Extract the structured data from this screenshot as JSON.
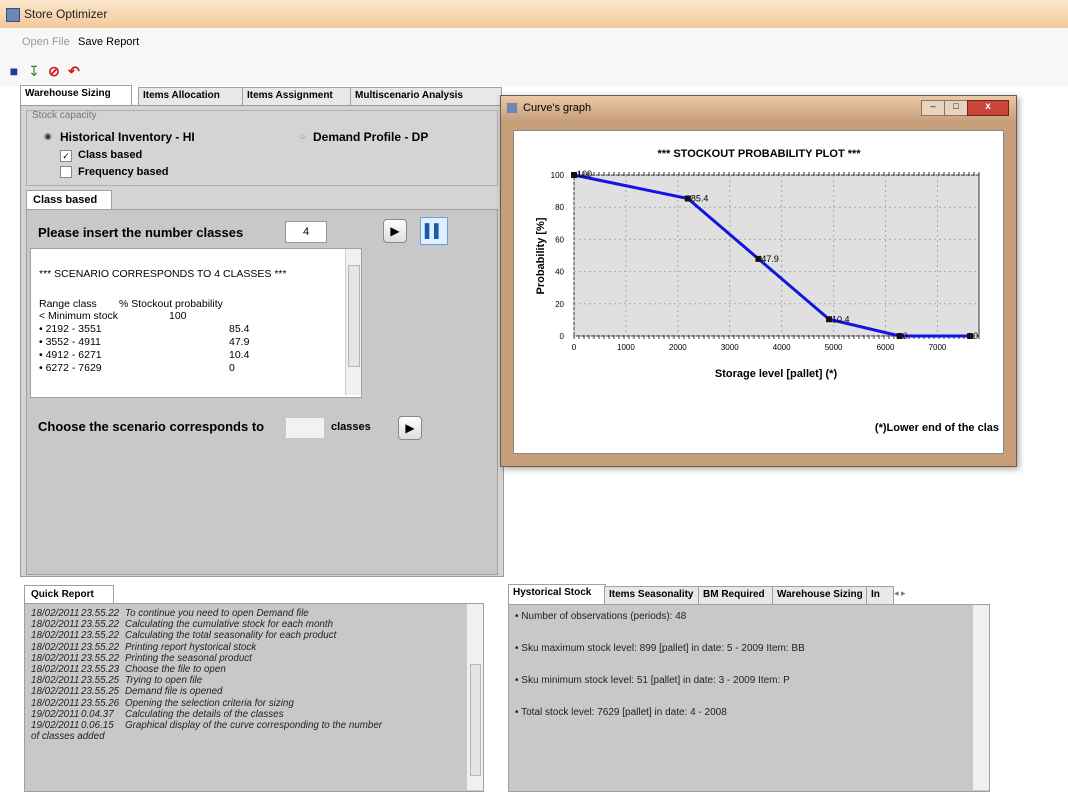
{
  "app": {
    "title": "Store Optimizer"
  },
  "menu": {
    "open_file": "Open File",
    "save_report": "Save Report"
  },
  "toolbar": {
    "icons": [
      "save-icon",
      "download-icon",
      "stop-icon",
      "undo-icon"
    ]
  },
  "main_tabs": [
    {
      "label": "Warehouse Sizing",
      "active": true
    },
    {
      "label": "Items Allocation"
    },
    {
      "label": "Items Assignment"
    },
    {
      "label": "Multiscenario Analysis"
    }
  ],
  "stock_capacity": {
    "label": "Stock capacity",
    "historical": "Historical  Inventory - HI",
    "demand": "Demand Profile - DP",
    "class_based": "Class based",
    "frequency_based": "Frequency based"
  },
  "class_panel": {
    "tab": "Class based",
    "insert_label": "Please insert the number classes",
    "classes_value": "4",
    "choose_label": "Choose the scenario corresponds to",
    "choose_value": "",
    "classes_suffix": "classes"
  },
  "scenario": {
    "header": "*** SCENARIO CORRESPONDS TO 4 CLASSES ***",
    "col1": "Range class",
    "col2": "% Stockout probability",
    "rows": [
      {
        "range": "< Minimum stock",
        "prob": "100"
      },
      {
        "range": "• 2192 - 3551",
        "prob": "85.4"
      },
      {
        "range": "• 3552 - 4911",
        "prob": "47.9"
      },
      {
        "range": "• 4912 - 6271",
        "prob": "10.4"
      },
      {
        "range": "• 6272 - 7629",
        "prob": "0"
      }
    ]
  },
  "curve_window": {
    "title": "Curve's graph",
    "footnote": "(*)Lower end of the clas"
  },
  "chart_data": {
    "type": "line",
    "title": "*** STOCKOUT PROBABILITY PLOT ***",
    "xlabel": "Storage level  [pallet]  (*)",
    "ylabel": "Probability [%]",
    "xlim": [
      0,
      7800
    ],
    "ylim": [
      0,
      100
    ],
    "x_ticks": [
      0,
      1000,
      2000,
      3000,
      4000,
      5000,
      6000,
      7000
    ],
    "y_ticks": [
      0,
      20,
      40,
      60,
      80,
      100
    ],
    "series": [
      {
        "x": [
          0,
          2192,
          3552,
          4912,
          6272,
          7629
        ],
        "y": [
          100,
          85.4,
          47.9,
          10.4,
          0,
          0
        ],
        "labels": [
          "100",
          "85.4",
          "47.9",
          "10.4",
          "0",
          "0"
        ],
        "color": "#1414e0"
      }
    ],
    "grid": true,
    "colors": {
      "plot_bg": "#e0e0e0",
      "line": "#1414e0"
    }
  },
  "quick_report": {
    "tab": "Quick Report",
    "rows": [
      {
        "date": "18/02/2011",
        "time": "23.55.22",
        "msg": "To continue you need to open Demand file"
      },
      {
        "date": "18/02/2011",
        "time": "23.55.22",
        "msg": "Calculating the cumulative stock for each month"
      },
      {
        "date": "18/02/2011",
        "time": "23.55.22",
        "msg": "Calculating the total seasonality for each product"
      },
      {
        "date": "18/02/2011",
        "time": "23.55.22",
        "msg": "Printing report hystorical stock"
      },
      {
        "date": "18/02/2011",
        "time": "23.55.22",
        "msg": "Printing the seasonal product"
      },
      {
        "date": "18/02/2011",
        "time": "23.55.23",
        "msg": "Choose the file to open"
      },
      {
        "date": "18/02/2011",
        "time": "23.55.25",
        "msg": "Trying to open file"
      },
      {
        "date": "18/02/2011",
        "time": "23.55.25",
        "msg": "Demand file is opened"
      },
      {
        "date": "18/02/2011",
        "time": "23.55.26",
        "msg": "Opening the selection criteria for sizing"
      },
      {
        "date": "19/02/2011",
        "time": "0.04.37",
        "msg": "Calculating the details of the classes"
      },
      {
        "date": "19/02/2011",
        "time": "0.06.15",
        "msg": "Graphical display of the curve corresponding to the number"
      }
    ],
    "wrap": "of classes added"
  },
  "bottom_tabs": [
    {
      "label": "Hystorical Stock",
      "active": true
    },
    {
      "label": "Items Seasonality"
    },
    {
      "label": "BM Required"
    },
    {
      "label": "Warehouse Sizing"
    },
    {
      "label": "In"
    }
  ],
  "hist_stock": {
    "lines": [
      "• Number of observations (periods): 48",
      "• Sku maximum stock level: 899 [pallet]  in date: 5 - 2009  Item: BB",
      "• Sku minimum stock level: 51 [pallet]  in date: 3 - 2009  Item: P",
      "• Total stock level: 7629 [pallet]  in date: 4 - 2008"
    ]
  }
}
